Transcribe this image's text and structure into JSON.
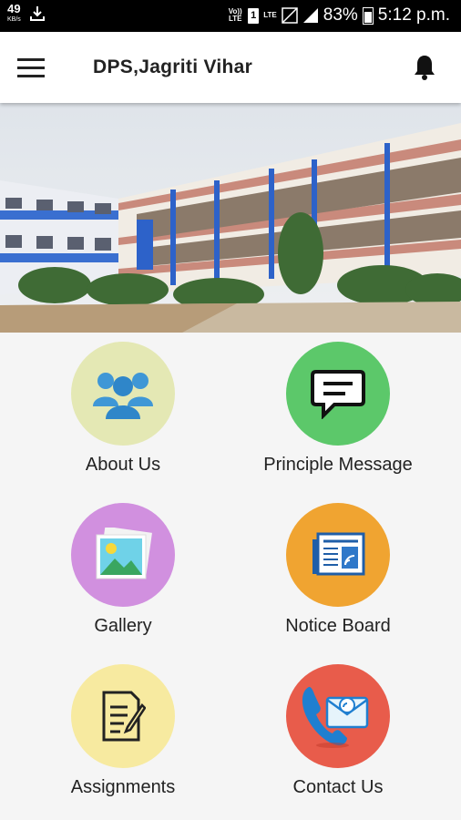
{
  "status_bar": {
    "speed": "49",
    "speed_unit": "KB/s",
    "volte": "Vo)) LTE",
    "lte": "LTE",
    "sim": "1",
    "battery": "83%",
    "time": "5:12 p.m."
  },
  "app_bar": {
    "title": "DPS,Jagriti Vihar"
  },
  "tiles": [
    {
      "label": "About Us",
      "color": "#e4e8b4",
      "icon": "people-icon"
    },
    {
      "label": "Principle Message",
      "color": "#5cc86a",
      "icon": "message-icon"
    },
    {
      "label": "Gallery",
      "color": "#d190df",
      "icon": "gallery-icon"
    },
    {
      "label": "Notice Board",
      "color": "#f0a431",
      "icon": "newspaper-icon"
    },
    {
      "label": "Assignments",
      "color": "#f7eaa0",
      "icon": "document-icon"
    },
    {
      "label": "Contact Us",
      "color": "#e85c4b",
      "icon": "contact-icon"
    }
  ]
}
